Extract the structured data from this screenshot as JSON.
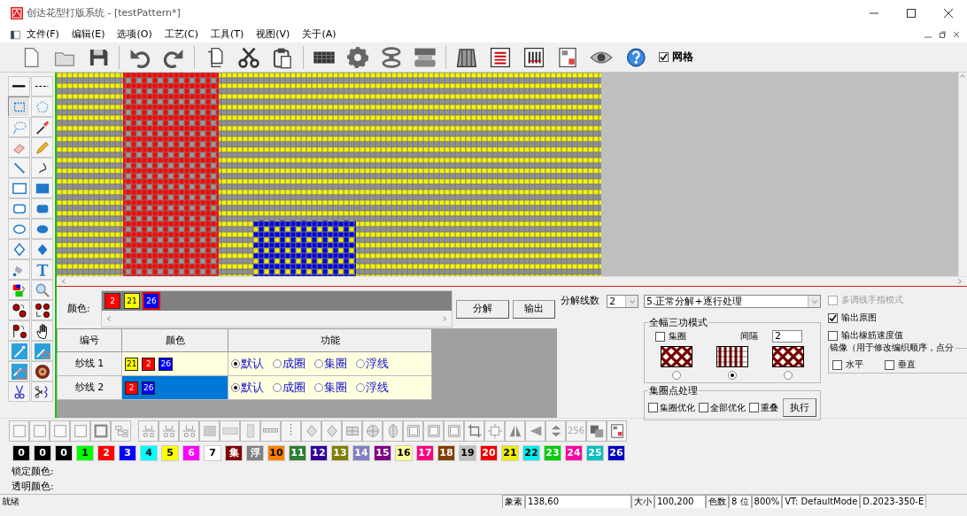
{
  "window": {
    "title": "创达花型打版系统 - [testPattern*]"
  },
  "menu": [
    "文件(F)",
    "编辑(E)",
    "选项(O)",
    "工艺(C)",
    "工具(T)",
    "视图(V)",
    "关于(A)"
  ],
  "toolbar": {
    "tools": [
      {
        "kind": "new"
      },
      {
        "kind": "open"
      },
      {
        "kind": "save"
      },
      {
        "kind": "sep"
      },
      {
        "kind": "undo"
      },
      {
        "kind": "redo"
      },
      {
        "kind": "sep"
      },
      {
        "kind": "copy"
      },
      {
        "kind": "cut"
      },
      {
        "kind": "paste"
      },
      {
        "kind": "sep"
      },
      {
        "kind": "knitgrid"
      },
      {
        "kind": "gear"
      },
      {
        "kind": "spool"
      },
      {
        "kind": "roller"
      },
      {
        "kind": "sep"
      },
      {
        "kind": "machine"
      },
      {
        "kind": "list"
      },
      {
        "kind": "bars"
      },
      {
        "kind": "docs"
      },
      {
        "kind": "eye"
      },
      {
        "kind": "help"
      }
    ],
    "grid": {
      "label": "网格",
      "checked": true
    }
  },
  "tool_palette": [
    {
      "kind": "line-solid",
      "selected": false
    },
    {
      "kind": "line-dashed",
      "selected": false
    },
    {
      "kind": "rect-select",
      "selected": true
    },
    {
      "kind": "poly-select",
      "selected": false
    },
    {
      "kind": "lasso",
      "selected": false
    },
    {
      "kind": "eyedropper",
      "selected": false
    },
    {
      "kind": "eraser",
      "selected": false
    },
    {
      "kind": "pencil",
      "selected": false
    },
    {
      "kind": "line",
      "selected": false
    },
    {
      "kind": "curve",
      "selected": false
    },
    {
      "kind": "rect",
      "selected": false
    },
    {
      "kind": "rect-fill",
      "selected": false
    },
    {
      "kind": "round",
      "selected": false
    },
    {
      "kind": "round-fill",
      "selected": false
    },
    {
      "kind": "ellipse",
      "selected": false
    },
    {
      "kind": "ellipse-fill",
      "selected": false
    },
    {
      "kind": "diamond",
      "selected": false
    },
    {
      "kind": "diamond-fill",
      "selected": false
    },
    {
      "kind": "bucket",
      "selected": false
    },
    {
      "kind": "text",
      "selected": false
    },
    {
      "kind": "swap",
      "selected": false
    },
    {
      "kind": "zoom",
      "selected": false
    },
    {
      "kind": "flower-copy",
      "selected": false
    },
    {
      "kind": "flower-grid",
      "selected": false
    },
    {
      "kind": "flower-flag",
      "selected": false
    },
    {
      "kind": "hand",
      "selected": false
    },
    {
      "kind": "wand",
      "selected": false
    },
    {
      "kind": "wand-square",
      "selected": false
    },
    {
      "kind": "wand-frame",
      "selected": false
    },
    {
      "kind": "flower",
      "selected": false
    },
    {
      "kind": "scissors",
      "selected": false
    },
    {
      "kind": "scissors-curve",
      "selected": false
    }
  ],
  "color_panel": {
    "label": "颜色:",
    "chips": [
      {
        "label": "2",
        "color": "#ff0000",
        "selected": false
      },
      {
        "label": "21",
        "color": "#ffff00",
        "selected": false
      },
      {
        "label": "26",
        "color": "#0000ff",
        "selected": true
      }
    ],
    "buttons": [
      "分解",
      "输出"
    ]
  },
  "split_count": {
    "label": "分解线数",
    "value": "2"
  },
  "yarn_table": {
    "columns": [
      "编号",
      "颜色",
      "功能"
    ],
    "rows": [
      {
        "name": "纱线 1",
        "selected": false,
        "colors": [
          {
            "label": "21",
            "color": "#ffff00"
          },
          {
            "label": "2",
            "color": "#ff0000"
          },
          {
            "label": "26",
            "color": "#0000ff"
          }
        ],
        "options": [
          {
            "label": "默认",
            "selected": true
          },
          {
            "label": "成圈",
            "selected": false
          },
          {
            "label": "集圈",
            "selected": false
          },
          {
            "label": "浮线",
            "selected": false
          }
        ]
      },
      {
        "name": "纱线 2",
        "selected": true,
        "colors": [
          {
            "label": "2",
            "color": "#ff0000"
          },
          {
            "label": "26",
            "color": "#0000ff"
          }
        ],
        "options": [
          {
            "label": "默认",
            "selected": true
          },
          {
            "label": "成圈",
            "selected": false
          },
          {
            "label": "集圈",
            "selected": false
          },
          {
            "label": "浮线",
            "selected": false
          }
        ]
      }
    ]
  },
  "mode_select": {
    "value": "5.正常分解+逐行处理"
  },
  "full_width": {
    "title": "全幅三功模式",
    "tuck": {
      "label": "集圈",
      "checked": false
    },
    "interval_label": "间隔",
    "interval": "2",
    "patterns": [
      {
        "kind": "diagonal",
        "selected": false
      },
      {
        "kind": "stripes",
        "selected": true
      },
      {
        "kind": "diagonal",
        "selected": false
      }
    ]
  },
  "tuck_points": {
    "title": "集圈点处理",
    "options": [
      {
        "label": "集圈优化",
        "checked": false
      },
      {
        "label": "全部优化",
        "checked": false
      },
      {
        "label": "重叠",
        "checked": false
      }
    ],
    "button": "执行"
  },
  "options": [
    {
      "label": "多调线手指模式",
      "checked": false,
      "disabled": true
    },
    {
      "label": "输出原图",
      "checked": true,
      "disabled": false
    },
    {
      "label": "输出橡筋速度值",
      "checked": false,
      "disabled": false
    }
  ],
  "mirror": {
    "title": "镜像（用于修改编织顺序，点分",
    "options": [
      {
        "label": "水平",
        "checked": false
      },
      {
        "label": "垂直",
        "checked": false
      }
    ]
  },
  "bottom_tools": [
    {
      "kind": "square"
    },
    {
      "kind": "square"
    },
    {
      "kind": "square"
    },
    {
      "kind": "square"
    },
    {
      "kind": "frame"
    },
    {
      "kind": "tree"
    },
    {
      "kind": "sep"
    },
    {
      "kind": "fork"
    },
    {
      "kind": "fork"
    },
    {
      "kind": "fork"
    },
    {
      "kind": "dense"
    },
    {
      "kind": "hatch"
    },
    {
      "kind": "column"
    },
    {
      "kind": "dotted-line"
    },
    {
      "kind": "dotted-column"
    },
    {
      "kind": "diamond-dots"
    },
    {
      "kind": "diamond-dots"
    },
    {
      "kind": "mesh"
    },
    {
      "kind": "circle-mesh"
    },
    {
      "kind": "oval-mesh"
    },
    {
      "kind": "panel"
    },
    {
      "kind": "panel"
    },
    {
      "kind": "panel"
    },
    {
      "kind": "crop"
    },
    {
      "kind": "move"
    },
    {
      "kind": "flip-h"
    },
    {
      "kind": "flip-v"
    },
    {
      "kind": "rotate"
    },
    {
      "kind": "label",
      "label": "256"
    },
    {
      "kind": "stack"
    },
    {
      "kind": "docs"
    }
  ],
  "palette": [
    {
      "label": "0",
      "color": "#000000"
    },
    {
      "label": "0",
      "color": "#000000"
    },
    {
      "label": "0",
      "color": "#000000"
    },
    {
      "label": "1",
      "color": "#00ff00"
    },
    {
      "label": "2",
      "color": "#ff0000"
    },
    {
      "label": "3",
      "color": "#0000ff"
    },
    {
      "label": "4",
      "color": "#00ffff"
    },
    {
      "label": "5",
      "color": "#ffff00"
    },
    {
      "label": "6",
      "color": "#ff00ff"
    },
    {
      "label": "7",
      "color": "#ffffff"
    },
    {
      "label": "集",
      "color": "#800000"
    },
    {
      "label": "浮",
      "color": "#808080"
    },
    {
      "label": "10",
      "color": "#ff8000"
    },
    {
      "label": "11",
      "color": "#2e7d32"
    },
    {
      "label": "12",
      "color": "#330099"
    },
    {
      "label": "13",
      "color": "#808000"
    },
    {
      "label": "14",
      "color": "#8080c0"
    },
    {
      "label": "15",
      "color": "#800080"
    },
    {
      "label": "16",
      "color": "#ffff99"
    },
    {
      "label": "17",
      "color": "#ff0080"
    },
    {
      "label": "18",
      "color": "#804000"
    },
    {
      "label": "19",
      "color": "#c0c0c0"
    },
    {
      "label": "20",
      "color": "#ee0000"
    },
    {
      "label": "21",
      "color": "#eeee00"
    },
    {
      "label": "22",
      "color": "#00eeee"
    },
    {
      "label": "23",
      "color": "#00cc00"
    },
    {
      "label": "24",
      "color": "#ff00a0"
    },
    {
      "label": "25",
      "color": "#00c0c0"
    },
    {
      "label": "26",
      "color": "#0000c0"
    }
  ],
  "lock_color": {
    "label": "锁定颜色:"
  },
  "transparent_color": {
    "label": "透明颜色:"
  },
  "status_bar": {
    "message": "就绪",
    "fields": [
      {
        "label": "象素",
        "value": "138,60"
      },
      {
        "label": "大小",
        "value": "100,200"
      },
      {
        "label": "色数",
        "value": "8 位"
      },
      {
        "value": "800%"
      },
      {
        "value": "VT: DefaultMode"
      },
      {
        "value": "D.2023-350-E"
      }
    ]
  }
}
